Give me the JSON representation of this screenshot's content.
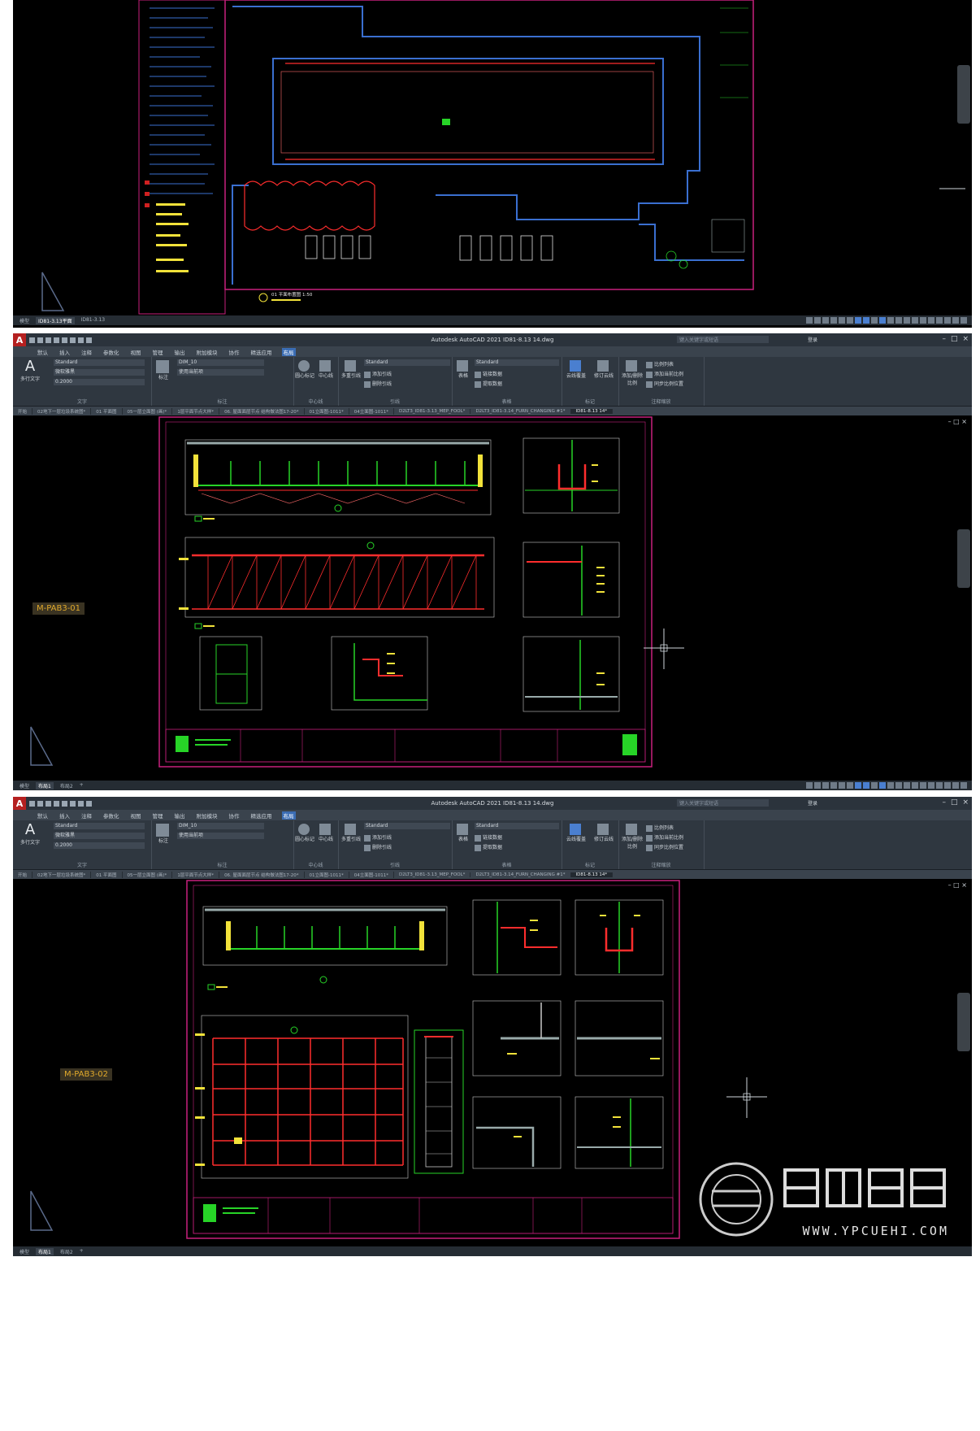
{
  "app": {
    "title": "Autodesk AutoCAD 2021  ID81-8.13 14.dwg",
    "search_placeholder": "键入关键字或短语",
    "user": "登录",
    "logo": "A"
  },
  "menu_tabs": [
    "默认",
    "插入",
    "注释",
    "参数化",
    "视图",
    "管理",
    "输出",
    "附加模块",
    "协作",
    "精选应用",
    "布局"
  ],
  "menu_active_index": 2,
  "ribbon": {
    "text_panel": {
      "button": "多行文字",
      "style": "Standard",
      "font": "微软雅黑",
      "height": "0.2000",
      "label": "文字"
    },
    "dim_panel": {
      "button": "标注",
      "layer": "DIM_10",
      "style": "使用当前项",
      "label": "标注"
    },
    "center_panel": {
      "button1": "圆心标记",
      "button2": "中心线",
      "label": "中心线"
    },
    "leader_panel": {
      "button": "多重引线",
      "style": "Standard",
      "add": "添加引线",
      "remove": "删除引线",
      "label": "引线"
    },
    "table_panel": {
      "button": "表格",
      "style": "Standard",
      "link": "链接数据",
      "extract": "提取数据",
      "label": "表格"
    },
    "markup_panel": {
      "button1": "云线覆盖",
      "button2": "修订云线",
      "label": "标记"
    },
    "scale_panel": {
      "button": "添加/删除比例",
      "item1": "比例列表",
      "item2": "添加当前比例",
      "item3": "同步比例位置",
      "label": "注释缩放"
    }
  },
  "file_tabs": [
    "开始",
    "02地下一层垃圾系统图*",
    "01 平面图",
    "05一层立面图 (画)*",
    "1层平面节点大样*",
    "06. 屋面面层节点 结构做法图17-20*",
    "01立面图-1011*",
    "04立面图-1011*",
    "D2LT3_ID81-3.13_MEP_FOOL*",
    "D2LT3_ID81-3.14_FURN_CHANGING #1*",
    "ID81-8.13 14*"
  ],
  "file_tab_active": 10,
  "layout_tabs": [
    "模型",
    "布局1",
    "布局2"
  ],
  "top_layout_tabs": [
    "模型",
    "ID81-3.13平面",
    "ID81-3.13"
  ],
  "top_caption": "01 平面布置图 1:50",
  "sheets": [
    {
      "label": "M-PAB3-01"
    },
    {
      "label": "M-PAB3-02"
    }
  ],
  "watermark": {
    "text": "WWW.YPCUEHI.COM"
  },
  "colors": {
    "ribbon_bg": "#2f3740",
    "active_tab": "#3b6db4",
    "drawing_red": "#ff2d2d",
    "drawing_green": "#27d427",
    "drawing_yellow": "#f2e23a",
    "border_magenta": "#c8207d",
    "sheet_label": "#e0a92c"
  }
}
